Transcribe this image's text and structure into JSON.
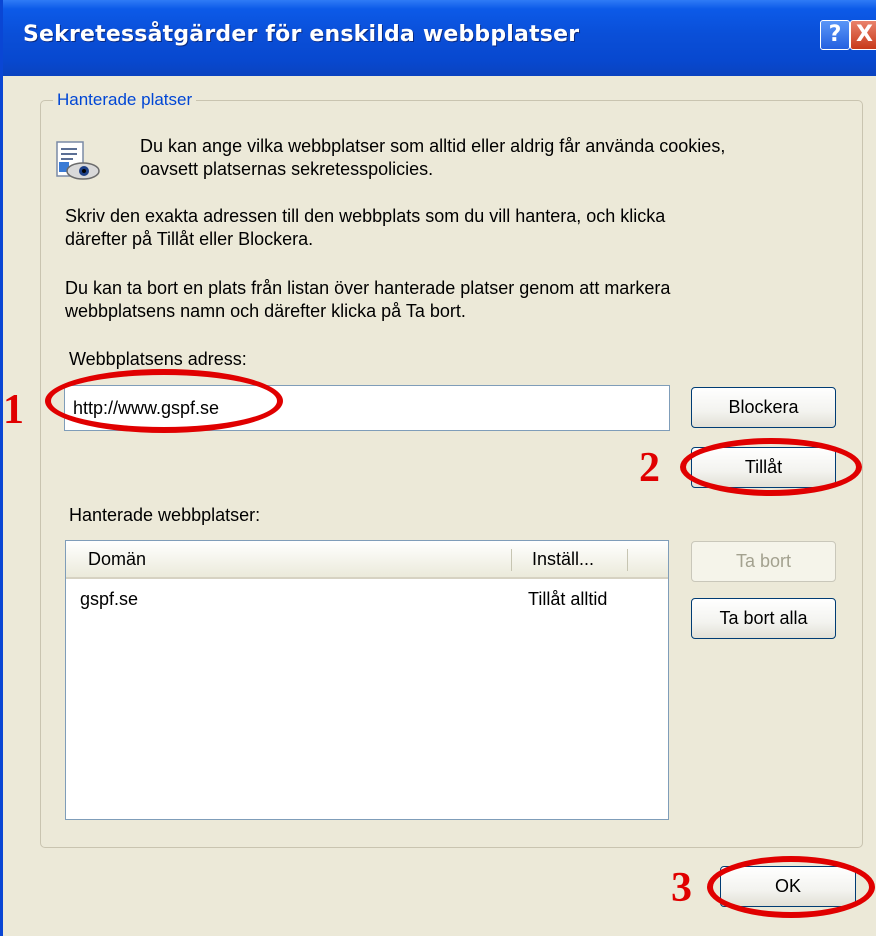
{
  "window": {
    "title": "Sekretessåtgärder för enskilda webbplatser",
    "help_label": "?",
    "close_label": "X"
  },
  "group": {
    "legend": "Hanterade platser",
    "intro_line1": "Du kan ange vilka webbplatser som alltid eller aldrig får använda cookies,",
    "intro_line2": "oavsett platsernas sekretesspolicies.",
    "instr_line1": "Skriv den exakta adressen till den webbplats som du vill hantera, och klicka",
    "instr_line2": "därefter på Tillåt eller Blockera.",
    "remove_line1": "Du kan ta bort en plats från listan över hanterade platser genom att markera",
    "remove_line2": "webbplatsens namn och därefter klicka på Ta bort.",
    "address_label": "Webbplatsens adress:",
    "address_value": "http://www.gspf.se",
    "managed_label": "Hanterade webbplatser:"
  },
  "buttons": {
    "block": "Blockera",
    "allow": "Tillåt",
    "remove": "Ta bort",
    "remove_all": "Ta bort alla",
    "ok": "OK"
  },
  "list": {
    "columns": [
      "Domän",
      "Inställ..."
    ],
    "rows": [
      {
        "domain": "gspf.se",
        "setting": "Tillåt alltid"
      }
    ]
  },
  "annotations": {
    "step1": "1",
    "step2": "2",
    "step3": "3",
    "color": "#e00000"
  },
  "colors": {
    "titlebar": "#0a4fd8",
    "dialog_bg": "#ece9d8",
    "legend_text": "#0046d5"
  }
}
